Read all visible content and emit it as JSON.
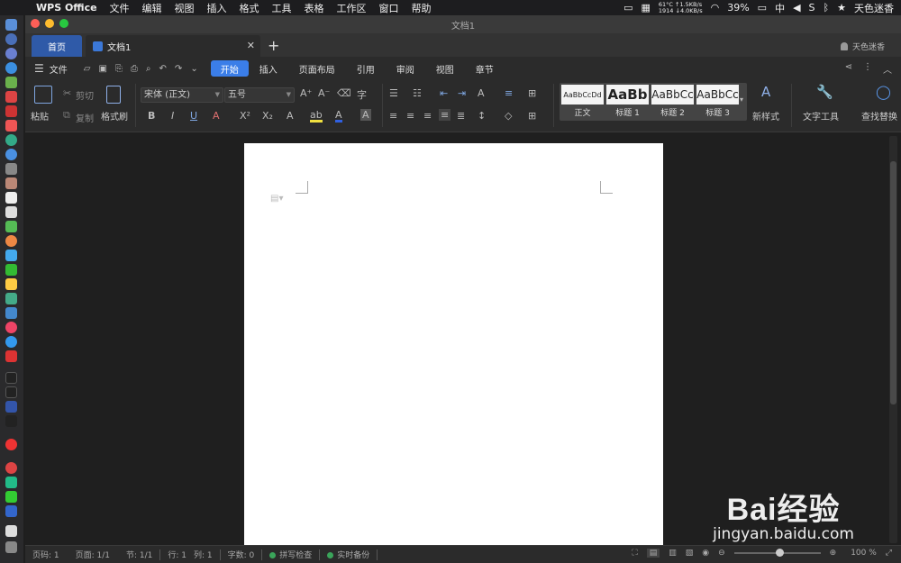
{
  "menubar": {
    "app_name": "WPS Office",
    "items": [
      "文件",
      "编辑",
      "视图",
      "插入",
      "格式",
      "工具",
      "表格",
      "工作区",
      "窗口",
      "帮助"
    ],
    "net_line1": "61°C ↑1.5KB/s",
    "net_line2": "1914 ↓4.0KB/s",
    "battery": "39%",
    "ime": "中",
    "username": "天色迷香"
  },
  "window": {
    "title": "文档1",
    "tabs": {
      "home": "首页",
      "doc": "文档1"
    },
    "user": "天色迷香"
  },
  "menu": {
    "file": "文件",
    "tabs": [
      "开始",
      "插入",
      "页面布局",
      "引用",
      "审阅",
      "视图",
      "章节"
    ]
  },
  "ribbon": {
    "paste": "粘贴",
    "cut": "剪切",
    "copy": "复制",
    "format_painter": "格式刷",
    "font_name": "宋体 (正文)",
    "font_size": "五号",
    "styles": [
      {
        "preview": "AaBbCcDd",
        "label": "正文"
      },
      {
        "preview": "AaBb",
        "label": "标题 1"
      },
      {
        "preview": "AaBbCc",
        "label": "标题 2"
      },
      {
        "preview": "AaBbCc",
        "label": "标题 3"
      }
    ],
    "new_style": "新样式",
    "text_tools": "文字工具",
    "find_replace": "查找替换"
  },
  "status": {
    "page": "页码: 1",
    "pages": "页面: 1/1",
    "section": "节: 1/1",
    "row": "行: 1",
    "col": "列: 1",
    "words": "字数: 0",
    "spell": "拼写检查",
    "backup": "实时备份",
    "zoom": "100 %"
  },
  "watermark": {
    "brand": "Bai经验",
    "url": "jingyan.baidu.com"
  },
  "colors": {
    "accent": "#3b7ee8",
    "home_tab": "#2f5aa8",
    "page": "#ffffff",
    "background": "#1f1f1f"
  }
}
